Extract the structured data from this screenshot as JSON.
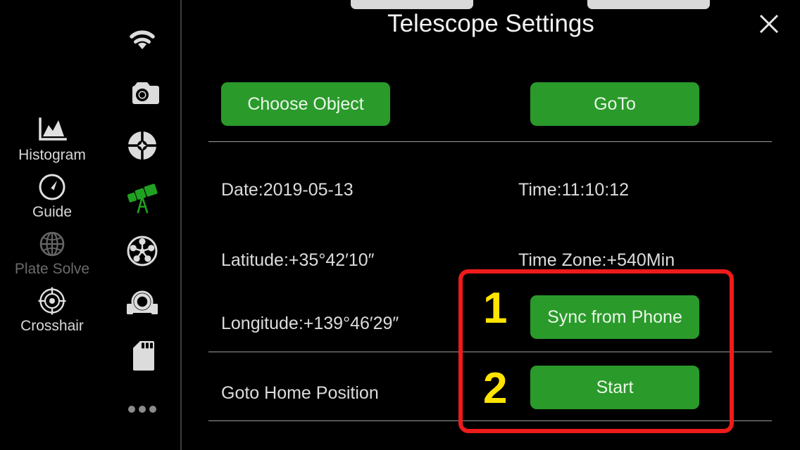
{
  "tools_column": {
    "items": [
      {
        "label": "Histogram",
        "icon": "histogram-icon",
        "enabled": true
      },
      {
        "label": "Guide",
        "icon": "guide-arrow-icon",
        "enabled": true
      },
      {
        "label": "Plate Solve",
        "icon": "globe-icon",
        "enabled": false
      },
      {
        "label": "Crosshair",
        "icon": "crosshair-icon",
        "enabled": true
      }
    ]
  },
  "icon_rail": {
    "items": [
      {
        "name": "wifi-icon"
      },
      {
        "name": "camera-icon"
      },
      {
        "name": "guider-reticle-icon"
      },
      {
        "name": "telescope-icon"
      },
      {
        "name": "filter-wheel-icon"
      },
      {
        "name": "focuser-icon"
      },
      {
        "name": "sd-card-icon"
      },
      {
        "name": "more-options-icon"
      }
    ]
  },
  "panel": {
    "title": "Telescope Settings",
    "close_icon": "close-icon"
  },
  "actions": {
    "choose_object": "Choose Object",
    "goto": "GoTo",
    "sync_from_phone": "Sync from Phone",
    "start": "Start"
  },
  "settings_rows": [
    {
      "left": "Date:2019-05-13",
      "right": "Time:11:10:12"
    },
    {
      "left": "Latitude:+35°42′10″",
      "right": "Time Zone:+540Min"
    },
    {
      "left": "Longitude:+139°46′29″"
    },
    {
      "left": "Goto Home Position"
    }
  ],
  "annotation": {
    "step_1": "1",
    "step_2": "2",
    "box_color": "#ef1b1b",
    "number_color": "#ffe400"
  },
  "colors": {
    "background": "#000000",
    "accent_green": "#2a9a2a",
    "text": "#dcdcdc",
    "divider": "#9a9a9a",
    "disabled_text": "#6b6b6b"
  }
}
